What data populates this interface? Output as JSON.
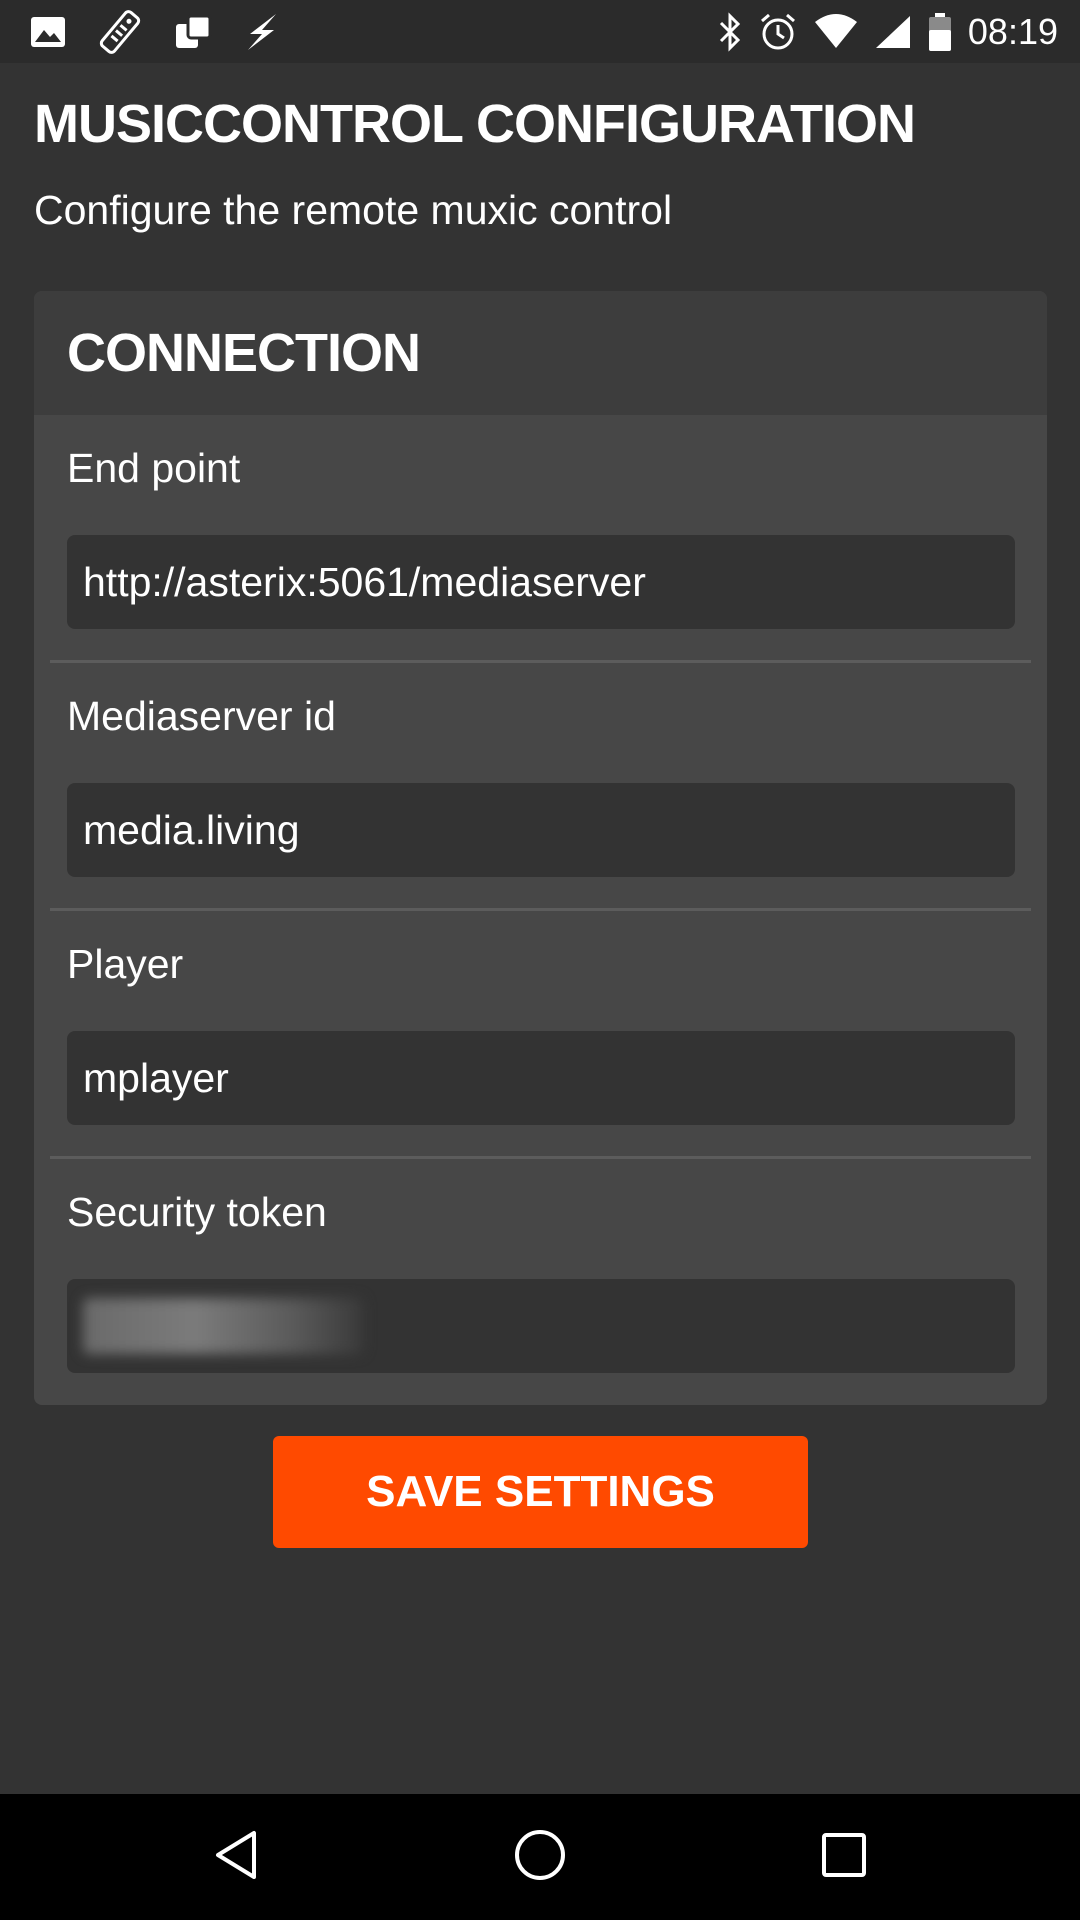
{
  "status_bar": {
    "left_icons": [
      "image-icon",
      "remote-control-icon",
      "dropbox-icon",
      "flash-icon"
    ],
    "right_icons": [
      "bluetooth-icon",
      "alarm-icon",
      "wifi-icon",
      "signal-icon",
      "battery-icon"
    ],
    "time": "08:19"
  },
  "page": {
    "title": "MUSICCONTROL CONFIGURATION",
    "subtitle": "Configure the remote muxic control"
  },
  "connection": {
    "header": "CONNECTION",
    "fields": [
      {
        "label": "End point",
        "value": "http://asterix:5061/mediaserver"
      },
      {
        "label": "Mediaserver id",
        "value": "media.living"
      },
      {
        "label": "Player",
        "value": "mplayer"
      },
      {
        "label": "Security token",
        "value": ""
      }
    ]
  },
  "actions": {
    "save_label": "SAVE SETTINGS"
  },
  "navigation": {
    "buttons": [
      "back-icon",
      "home-icon",
      "recents-icon"
    ]
  },
  "colors": {
    "background": "#333333",
    "card": "#474747",
    "card_header": "#3d3d3d",
    "accent": "#ff4a00",
    "input_bg": "#333333"
  }
}
